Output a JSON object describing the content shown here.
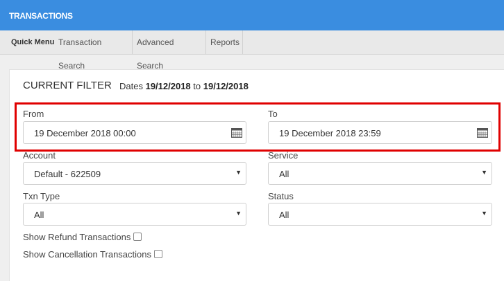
{
  "header": {
    "title": "TRANSACTIONS"
  },
  "menu": {
    "quick_menu": "Quick Menu",
    "items": [
      "Transaction Search",
      "Advanced Search",
      "Reports"
    ]
  },
  "filter": {
    "title": "CURRENT FILTER",
    "dates_prefix": "Dates",
    "date_from": "19/12/2018",
    "dates_to_word": "to",
    "date_to": "19/12/2018"
  },
  "form": {
    "from_label": "From",
    "from_value": "19 December 2018 00:00",
    "to_label": "To",
    "to_value": "19 December 2018 23:59",
    "account_label": "Account",
    "account_value": "Default - 622509",
    "service_label": "Service",
    "service_value": "All",
    "txn_type_label": "Txn Type",
    "txn_type_value": "All",
    "status_label": "Status",
    "status_value": "All",
    "refund_label": "Show Refund Transactions",
    "cancellation_label": "Show Cancellation Transactions"
  },
  "colors": {
    "header": "#3a8de0",
    "highlight": "#e00000"
  }
}
